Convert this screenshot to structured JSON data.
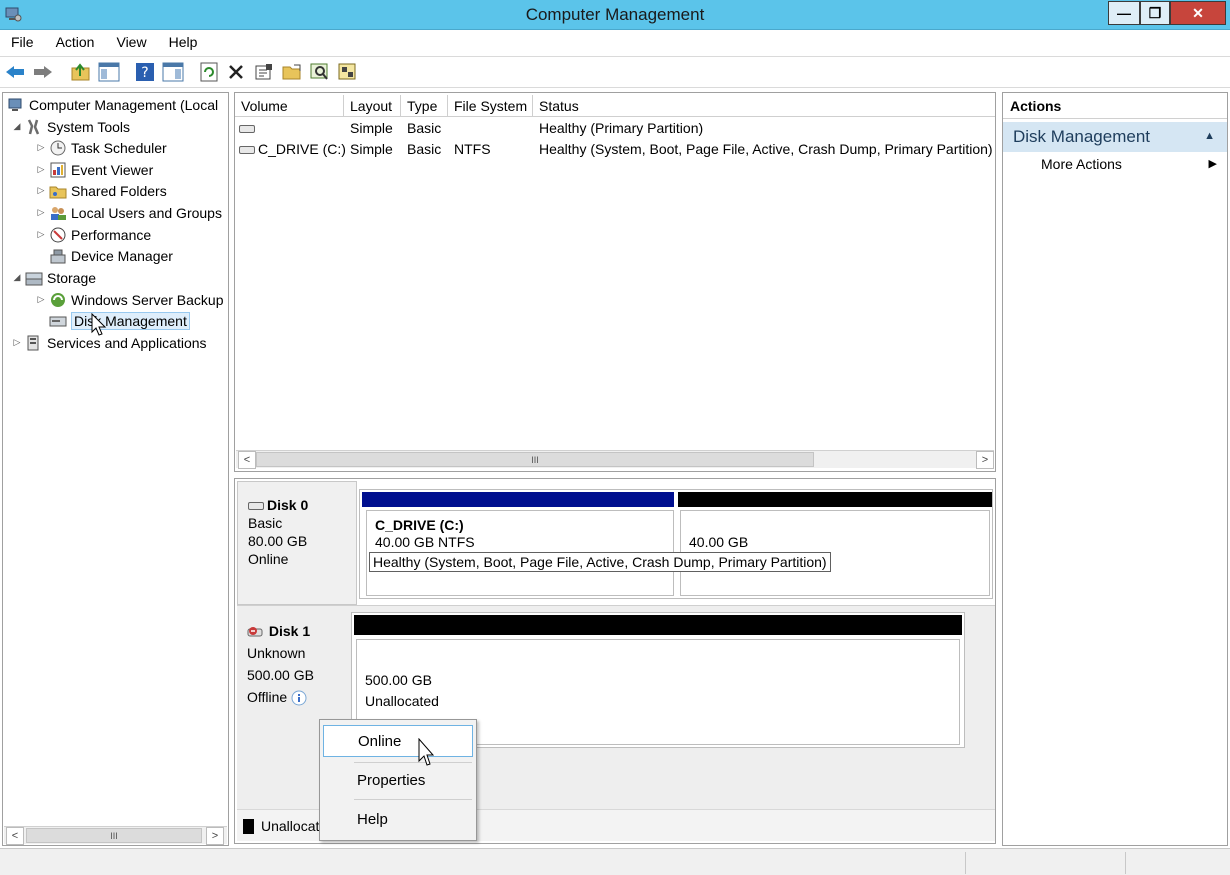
{
  "window": {
    "title": "Computer Management",
    "controls": {
      "minimize": "—",
      "restore": "❐",
      "close": "✕"
    }
  },
  "menubar": [
    "File",
    "Action",
    "View",
    "Help"
  ],
  "toolbar": [
    "back-icon",
    "forward-icon",
    "up-folder-icon",
    "show-hide-console-tree-icon",
    "help-icon",
    "show-hide-action-pane-icon",
    "refresh-icon",
    "delete-icon",
    "properties-icon",
    "open-icon",
    "zoom-icon",
    "settings-icon"
  ],
  "tree": {
    "root": "Computer Management (Local",
    "system_tools": "System Tools",
    "task_scheduler": "Task Scheduler",
    "event_viewer": "Event Viewer",
    "shared_folders": "Shared Folders",
    "local_users": "Local Users and Groups",
    "performance": "Performance",
    "device_manager": "Device Manager",
    "storage": "Storage",
    "wsb": "Windows Server Backup",
    "disk_management": "Disk Management",
    "services": "Services and Applications",
    "scroll_thumb": "III"
  },
  "volumes": {
    "columns": [
      "Volume",
      "Layout",
      "Type",
      "File System",
      "Status"
    ],
    "rows": [
      {
        "volume": "",
        "layout": "Simple",
        "type": "Basic",
        "fs": "",
        "status": "Healthy (Primary Partition)"
      },
      {
        "volume": "C_DRIVE (C:)",
        "layout": "Simple",
        "type": "Basic",
        "fs": "NTFS",
        "status": "Healthy (System, Boot, Page File, Active, Crash Dump, Primary Partition)"
      }
    ],
    "scroll_thumb": "III"
  },
  "disk0": {
    "name": "Disk 0",
    "type": "Basic",
    "size": "80.00 GB",
    "state": "Online",
    "partition_name": "C_DRIVE  (C:)",
    "partition_size": "40.00 GB NTFS",
    "partition_status": "Healthy (System, Boot, Page File, Active, Crash Dump, Primary Partition)",
    "second_partition_size": "40.00 GB",
    "colors": {
      "primary": "#000f8f",
      "unallocated": "#000000"
    }
  },
  "disk1": {
    "name": "Disk 1",
    "type": "Unknown",
    "size": "500.00 GB",
    "state": "Offline",
    "region_size": "500.00 GB",
    "region_label": "Unallocated"
  },
  "legend": {
    "unallocated": "Unallocate"
  },
  "context_menu": {
    "online": "Online",
    "properties": "Properties",
    "help": "Help"
  },
  "actions": {
    "header": "Actions",
    "section": "Disk Management",
    "more": "More Actions"
  }
}
